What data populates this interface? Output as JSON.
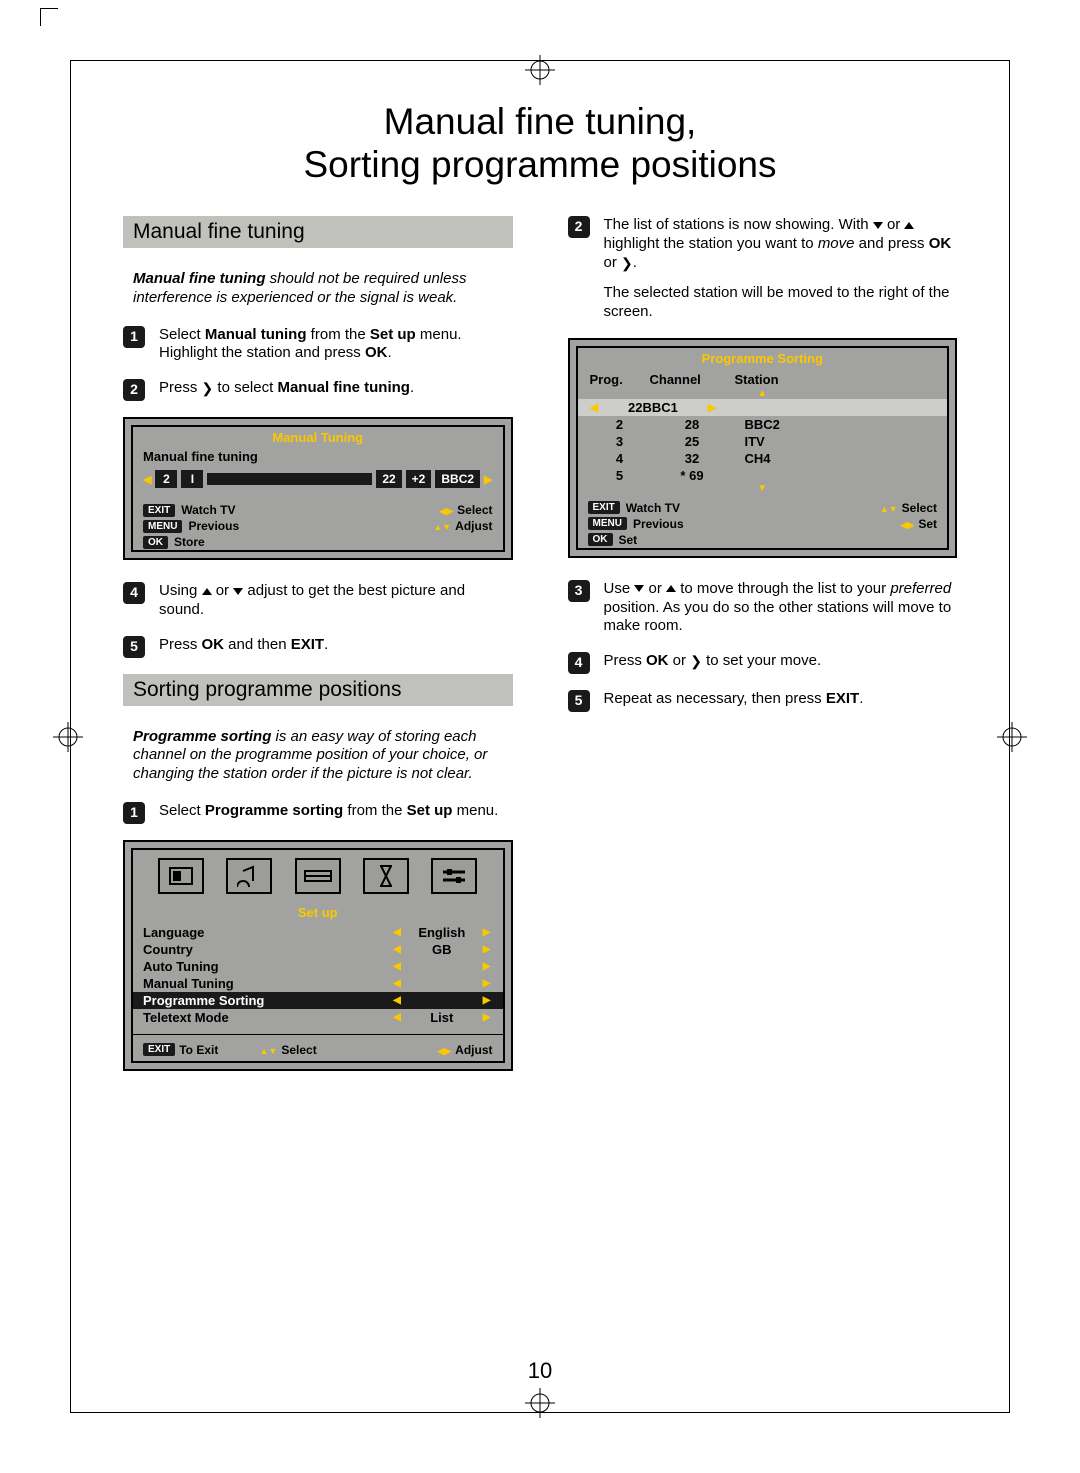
{
  "page_number": "10",
  "title_l1": "Manual fine tuning,",
  "title_l2": "Sorting programme positions",
  "left": {
    "section1": "Manual fine tuning",
    "intro1_b": "Manual fine tuning",
    "intro1_r": " should not be required unless interference is experienced or the signal is weak.",
    "s1": {
      "a": "Select ",
      "b": "Manual tuning",
      "c": " from the ",
      "d": "Set up",
      "e": " menu. Highlight the station and press ",
      "f": "OK",
      "g": "."
    },
    "s2": {
      "a": "Press ",
      "b": " to select ",
      "c": "Manual fine tuning",
      "d": "."
    },
    "osd1": {
      "title": "Manual Tuning",
      "sub": "Manual fine tuning",
      "prog": "2",
      "sys": "I",
      "ch": "22",
      "off": "+2",
      "stn": "BBC2",
      "h1k": "EXIT",
      "h1": "Watch TV",
      "h1r": "Select",
      "h2k": "MENU",
      "h2": "Previous",
      "h2r": "Adjust",
      "h3k": "OK",
      "h3": "Store"
    },
    "s4": {
      "a": "Using ",
      "b": " or ",
      "c": " adjust to get the best picture and sound."
    },
    "s5": {
      "a": "Press ",
      "b": "OK",
      "c": " and then ",
      "d": "EXIT",
      "e": "."
    },
    "section2": "Sorting programme positions",
    "intro2_b": "Programme sorting",
    "intro2_r": " is an easy way of storing each channel on the programme position of your choice, or changing the station order if the picture is not clear.",
    "sp1": {
      "a": "Select ",
      "b": "Programme sorting",
      "c": " from the ",
      "d": "Set up",
      "e": " menu."
    },
    "osd2": {
      "title": "Set up",
      "items": [
        {
          "label": "Language",
          "val": "English"
        },
        {
          "label": "Country",
          "val": "GB"
        },
        {
          "label": "Auto Tuning",
          "val": ""
        },
        {
          "label": "Manual Tuning",
          "val": ""
        },
        {
          "label": "Programme Sorting",
          "val": "",
          "sel": true
        },
        {
          "label": "Teletext Mode",
          "val": "List"
        }
      ],
      "hexit": "EXIT",
      "hexitl": "To Exit",
      "hsel": "Select",
      "hadj": "Adjust"
    }
  },
  "right": {
    "r2": {
      "a": "The list of stations is now showing. With ",
      "b": " or ",
      "c": " highlight the station you want to ",
      "d": "move",
      "e": " and press ",
      "f": "OK",
      "g": " or ",
      "h": "."
    },
    "r2p2": "The selected station will be moved to the right of the screen.",
    "osd3": {
      "title": "Programme Sorting",
      "head": {
        "c1": "Prog.",
        "c2": "Channel",
        "c3": "Station"
      },
      "sel": {
        "ch": "22",
        "stn": "BBC1"
      },
      "rows": [
        {
          "p": "2",
          "c": "28",
          "s": "BBC2"
        },
        {
          "p": "3",
          "c": "25",
          "s": "ITV"
        },
        {
          "p": "4",
          "c": "32",
          "s": "CH4"
        },
        {
          "p": "5",
          "c": "*    69",
          "s": ""
        }
      ],
      "h1k": "EXIT",
      "h1": "Watch TV",
      "h1r": "Select",
      "h2k": "MENU",
      "h2": "Previous",
      "h2r": "Set",
      "h3k": "OK",
      "h3": "Set"
    },
    "r3": {
      "a": "Use ",
      "b": " or ",
      "c": " to move through the list to your ",
      "d": "preferred",
      "e": " position. As you do so the other stations will move to make room."
    },
    "r4": {
      "a": "Press ",
      "b": "OK",
      "c": " or ",
      "d": " to set your move."
    },
    "r5": {
      "a": "Repeat as necessary, then press ",
      "b": "EXIT",
      "c": "."
    }
  }
}
